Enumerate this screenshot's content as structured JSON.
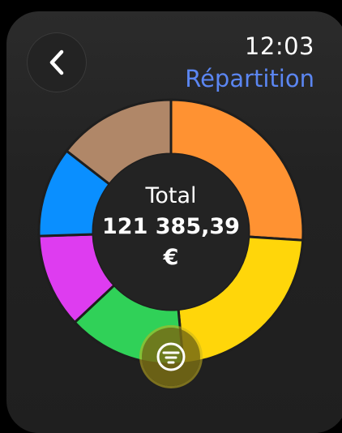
{
  "status": {
    "time": "12:03"
  },
  "header": {
    "title": "Répartition"
  },
  "navigation": {
    "back_icon": "chevron-left-icon"
  },
  "chart_data": {
    "type": "pie",
    "variant": "donut",
    "slices": [
      {
        "value": 26.0,
        "color": "#ff9232"
      },
      {
        "value": 22.5,
        "color": "#ffd60a"
      },
      {
        "value": 14.5,
        "color": "#30d158"
      },
      {
        "value": 11.5,
        "color": "#de3cf0"
      },
      {
        "value": 11.0,
        "color": "#0a8fff"
      },
      {
        "value": 14.5,
        "color": "#b08768"
      }
    ],
    "center": {
      "label": "Total",
      "value": "121 385,39",
      "currency": "€"
    }
  },
  "actions": {
    "filter_icon": "filter-lines-icon"
  },
  "colors": {
    "accent": "#5b86f2",
    "background": "#232323",
    "filter_button": "#786c14"
  }
}
